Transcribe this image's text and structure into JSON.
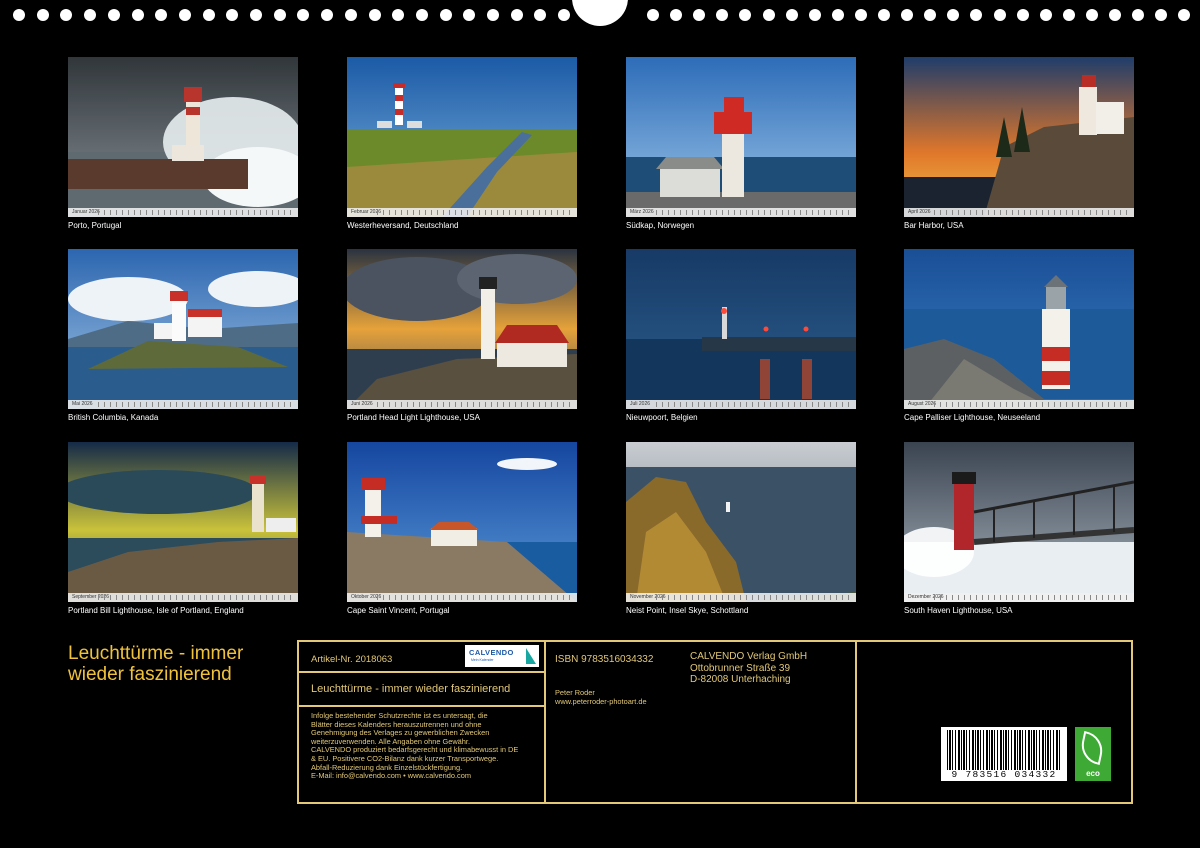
{
  "tiles": [
    {
      "caption": "Porto, Portugal",
      "month": "Januar 2026"
    },
    {
      "caption": "Westerheversand, Deutschland",
      "month": "Februar 2026"
    },
    {
      "caption": "Südkap, Norwegen",
      "month": "März 2026"
    },
    {
      "caption": "Bar Harbor, USA",
      "month": "April 2026"
    },
    {
      "caption": "British Columbia, Kanada",
      "month": "Mai 2026"
    },
    {
      "caption": "Portland Head Light Lighthouse, USA",
      "month": "Juni 2026"
    },
    {
      "caption": "Nieuwpoort, Belgien",
      "month": "Juli 2026"
    },
    {
      "caption": "Cape Palliser Lighthouse, Neuseeland",
      "month": "August 2026"
    },
    {
      "caption": "Portland Bill Lighthouse, Isle of Portland, England",
      "month": "September 2026"
    },
    {
      "caption": "Cape Saint Vincent, Portugal",
      "month": "Oktober 2026"
    },
    {
      "caption": "Neist Point, Insel Skye, Schottland",
      "month": "November 2026"
    },
    {
      "caption": "South Haven Lighthouse, USA",
      "month": "Dezember 2026"
    }
  ],
  "title": "Leuchttürme - immer wieder faszinierend",
  "info": {
    "article": "Artikel-Nr. 2018063",
    "logo": "CALVENDO",
    "logo_sub": "Mein Kalender",
    "product_title": "Leuchttürme - immer wieder faszinierend",
    "legal": [
      "Infolge bestehender Schutzrechte ist es untersagt, die",
      "Blätter dieses Kalenders herauszutrennen und ohne",
      "Genehmigung des Verlages zu gewerblichen Zwecken",
      "weiterzuverwenden. Alle Angaben ohne Gewähr.",
      "CALVENDO produziert bedarfsgerecht und klimabewusst in DE",
      "& EU. Positivere CO2-Bilanz dank kurzer Transportwege.",
      "Abfall-Reduzierung dank Einzelstückfertigung.",
      "E-Mail: info@calvendo.com • www.calvendo.com"
    ],
    "isbn": "ISBN 9783516034332",
    "author": "Peter Roder",
    "author_url": "www.peterroder-photoart.de",
    "publisher": [
      "CALVENDO Verlag GmbH",
      "Ottobrunner Straße 39",
      "D-82008 Unterhaching"
    ]
  },
  "barcode": "9 783516 034332",
  "eco_label": "eco",
  "colors": {
    "accent_gold": "#e2c877",
    "title_gold": "#f0c23c",
    "background": "#000000",
    "eco_green": "#3ea935"
  }
}
